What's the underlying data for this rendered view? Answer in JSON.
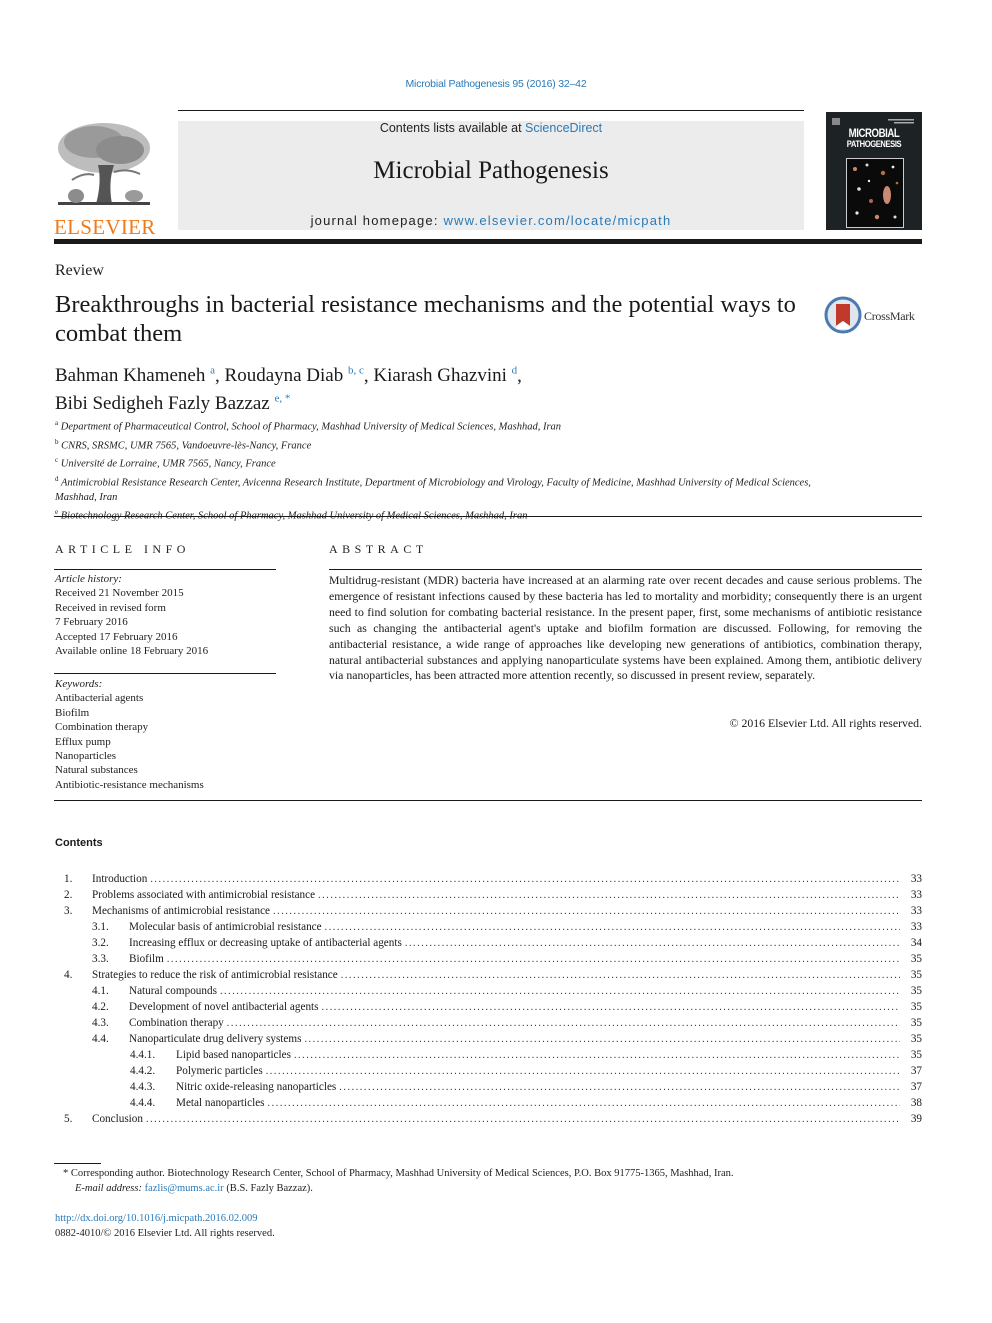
{
  "header": {
    "citation": "Microbial Pathogenesis 95 (2016) 32–42",
    "publisher_logo_text": "ELSEVIER",
    "contents_prefix": "Contents lists available at ",
    "contents_link": "ScienceDirect",
    "journal_title": "Microbial Pathogenesis",
    "homepage_prefix": "journal homepage: ",
    "homepage_link": "www.elsevier.com/locate/micpath",
    "cover_title_line1": "MICROBIAL",
    "cover_title_line2": "PATHOGENESIS",
    "colors": {
      "link": "#2a7ab8",
      "elsevier_orange": "#f07a1a",
      "banner_bg": "#ececec"
    }
  },
  "article": {
    "type": "Review",
    "title": "Breakthroughs in bacterial resistance mechanisms and the potential ways to combat them",
    "crossmark_label": "CrossMark",
    "authors": [
      {
        "name": "Bahman Khameneh",
        "sup": "a",
        "sep": ", "
      },
      {
        "name": "Roudayna Diab",
        "sup": "b, c",
        "sep": ", "
      },
      {
        "name": "Kiarash Ghazvini",
        "sup": "d",
        "sep": ","
      },
      {
        "name": "Bibi Sedigheh Fazly Bazzaz",
        "sup": "e, *",
        "sep": ""
      }
    ],
    "affiliations": [
      {
        "key": "a",
        "text": "Department of Pharmaceutical Control, School of Pharmacy, Mashhad University of Medical Sciences, Mashhad, Iran"
      },
      {
        "key": "b",
        "text": "CNRS, SRSMC, UMR 7565, Vandoeuvre-lès-Nancy, France"
      },
      {
        "key": "c",
        "text": "Université de Lorraine, UMR 7565, Nancy, France"
      },
      {
        "key": "d",
        "text": "Antimicrobial Resistance Research Center, Avicenna Research Institute, Department of Microbiology and Virology, Faculty of Medicine, Mashhad University of Medical Sciences, Mashhad, Iran"
      },
      {
        "key": "e",
        "text": "Biotechnology Research Center, School of Pharmacy, Mashhad University of Medical Sciences, Mashhad, Iran"
      }
    ]
  },
  "article_info": {
    "heading": "ARTICLE INFO",
    "history_label": "Article history:",
    "history": [
      "Received 21 November 2015",
      "Received in revised form",
      "7 February 2016",
      "Accepted 17 February 2016",
      "Available online 18 February 2016"
    ],
    "keywords_label": "Keywords:",
    "keywords": [
      "Antibacterial agents",
      "Biofilm",
      "Combination therapy",
      "Efflux pump",
      "Nanoparticles",
      "Natural substances",
      "Antibiotic-resistance mechanisms"
    ]
  },
  "abstract": {
    "heading": "ABSTRACT",
    "text": "Multidrug-resistant (MDR) bacteria have increased at an alarming rate over recent decades and cause serious problems. The emergence of resistant infections caused by these bacteria has led to mortality and morbidity; consequently there is an urgent need to find solution for combating bacterial resistance. In the present paper, first, some mechanisms of antibiotic resistance such as changing the antibacterial agent's uptake and biofilm formation are discussed. Following, for removing the antibacterial resistance, a wide range of approaches like developing new generations of antibiotics, combination therapy, natural antibacterial substances and applying nanoparticulate systems have been explained. Among them, antibiotic delivery via nanoparticles, has been attracted more attention recently, so discussed in present review, separately.",
    "copyright": "© 2016 Elsevier Ltd. All rights reserved."
  },
  "contents": {
    "heading": "Contents",
    "items": [
      {
        "num": "1.",
        "title": "Introduction",
        "page": "33",
        "level": 0
      },
      {
        "num": "2.",
        "title": "Problems associated with antimicrobial resistance",
        "page": "33",
        "level": 0
      },
      {
        "num": "3.",
        "title": "Mechanisms of antimicrobial resistance",
        "page": "33",
        "level": 0
      },
      {
        "num": "3.1.",
        "title": "Molecular basis of antimicrobial resistance",
        "page": "33",
        "level": 1
      },
      {
        "num": "3.2.",
        "title": "Increasing efflux or decreasing uptake of antibacterial agents",
        "page": "34",
        "level": 1
      },
      {
        "num": "3.3.",
        "title": "Biofilm",
        "page": "35",
        "level": 1
      },
      {
        "num": "4.",
        "title": "Strategies to reduce the risk of antimicrobial resistance",
        "page": "35",
        "level": 0
      },
      {
        "num": "4.1.",
        "title": "Natural compounds",
        "page": "35",
        "level": 1
      },
      {
        "num": "4.2.",
        "title": "Development of novel antibacterial agents",
        "page": "35",
        "level": 1
      },
      {
        "num": "4.3.",
        "title": "Combination therapy",
        "page": "35",
        "level": 1
      },
      {
        "num": "4.4.",
        "title": "Nanoparticulate drug delivery systems",
        "page": "35",
        "level": 1
      },
      {
        "num": "4.4.1.",
        "title": "Lipid based nanoparticles",
        "page": "35",
        "level": 2
      },
      {
        "num": "4.4.2.",
        "title": "Polymeric particles",
        "page": "37",
        "level": 2
      },
      {
        "num": "4.4.3.",
        "title": "Nitric oxide-releasing nanoparticles",
        "page": "37",
        "level": 2
      },
      {
        "num": "4.4.4.",
        "title": "Metal nanoparticles",
        "page": "38",
        "level": 2
      },
      {
        "num": "5.",
        "title": "Conclusion",
        "page": "39",
        "level": 0
      }
    ]
  },
  "footnote": {
    "marker": "*",
    "corresponding": "Corresponding author. Biotechnology Research Center, School of Pharmacy, Mashhad University of Medical Sciences, P.O. Box 91775-1365, Mashhad, Iran.",
    "email_label": "E-mail address:",
    "email": "fazlis@mums.ac.ir",
    "email_suffix": " (B.S. Fazly Bazzaz)."
  },
  "footer": {
    "doi": "http://dx.doi.org/10.1016/j.micpath.2016.02.009",
    "issn": "0882-4010/© 2016 Elsevier Ltd. All rights reserved."
  }
}
